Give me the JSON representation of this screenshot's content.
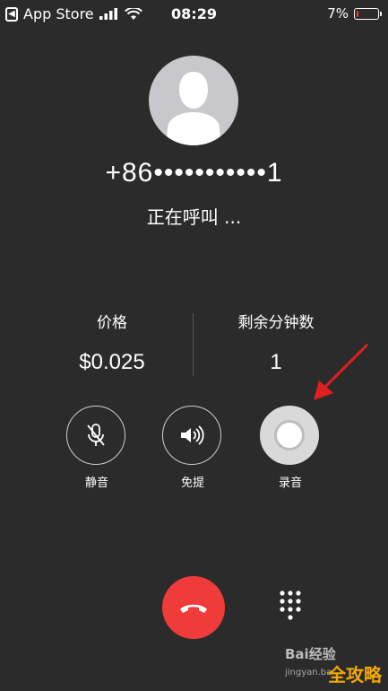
{
  "status_bar": {
    "back_app": "App Store",
    "time": "08:29",
    "battery_percent": "7%",
    "battery_level": 0.07,
    "battery_color": "#ff3b30"
  },
  "caller": {
    "avatar_icon": "person-silhouette-icon",
    "number": "+86•••••••••••1",
    "status": "正在呼叫 ..."
  },
  "info": {
    "price_label": "价格",
    "price_value": "$0.025",
    "minutes_label": "剩余分钟数",
    "minutes_value": "1"
  },
  "controls": {
    "mute_label": "静音",
    "speaker_label": "免提",
    "record_label": "录音"
  },
  "bottom": {
    "end_call_icon": "hang-up-icon",
    "keypad_icon": "keypad-icon",
    "end_call_color": "#ef3b3a"
  },
  "watermark": {
    "brand": "Bai经验",
    "url": "jingyan.ba",
    "corner": "全攻略"
  },
  "annotation": {
    "arrow_color": "#e02020"
  }
}
